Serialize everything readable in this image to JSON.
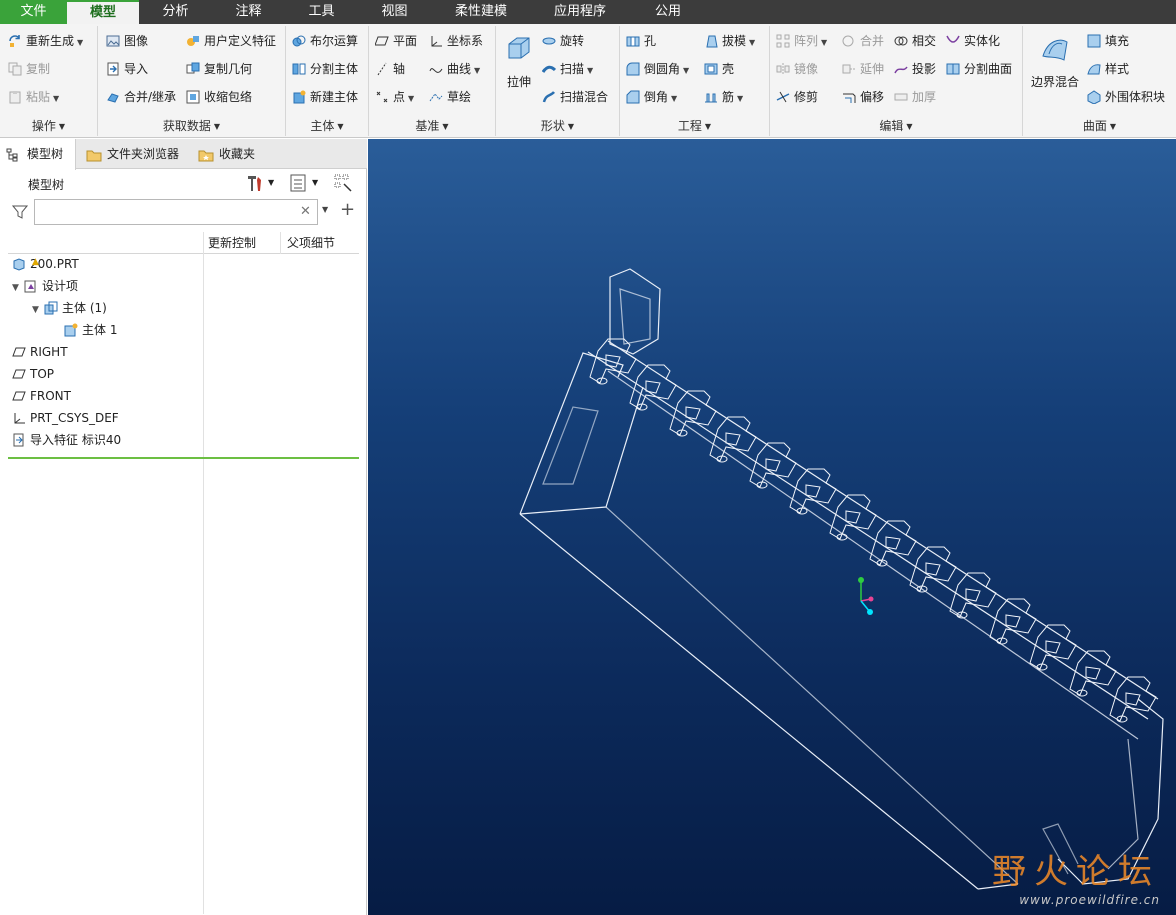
{
  "menu": {
    "tabs": [
      "文件",
      "模型",
      "分析",
      "注释",
      "工具",
      "视图",
      "柔性建模",
      "应用程序",
      "公用"
    ],
    "active": "模型"
  },
  "ribbon": {
    "ops": {
      "label": "操作",
      "regen": "重新生成",
      "copy": "复制",
      "paste": "粘贴"
    },
    "getdata": {
      "label": "获取数据",
      "image": "图像",
      "import": "导入",
      "merge": "合并/继承",
      "udf": "用户定义特征",
      "copygeom": "复制几何",
      "shrinkwrap": "收缩包络"
    },
    "body": {
      "label": "主体",
      "boolean": "布尔运算",
      "split": "分割主体",
      "newbody": "新建主体"
    },
    "datum": {
      "label": "基准",
      "plane": "平面",
      "csys": "坐标系",
      "axis": "轴",
      "curve": "曲线",
      "point": "点",
      "sketch": "草绘"
    },
    "shape": {
      "label": "形状",
      "extrude": "拉伸",
      "revolve": "旋转",
      "sweep": "扫描",
      "sweepblend": "扫描混合"
    },
    "eng": {
      "label": "工程",
      "hole": "孔",
      "draft": "拔模",
      "round": "倒圆角",
      "shell": "壳",
      "chamfer": "倒角",
      "rib": "筋"
    },
    "edit": {
      "label": "编辑",
      "pattern": "阵列",
      "merge": "合并",
      "intersect": "相交",
      "solidify": "实体化",
      "mirror": "镜像",
      "extend": "延伸",
      "project": "投影",
      "splitsurf": "分割曲面",
      "trim": "修剪",
      "offset": "偏移",
      "thicken": "加厚"
    },
    "surface": {
      "label": "曲面",
      "boundary": "边界混合",
      "fill": "填充",
      "style": "样式",
      "freestyle": "外围体积块"
    }
  },
  "panel": {
    "tabs": [
      "模型树",
      "文件夹浏览器",
      "收藏夹"
    ],
    "tree_title": "模型树",
    "search_placeholder": "",
    "columns": [
      "更新控制",
      "父项细节"
    ],
    "tree": [
      {
        "label": "200.PRT",
        "level": 0,
        "icon": "part-icon",
        "expander": ""
      },
      {
        "label": "设计项",
        "level": 0,
        "icon": "design-items-icon",
        "expander": "▼"
      },
      {
        "label": "主体 (1)",
        "level": 1,
        "icon": "bodies-icon",
        "expander": "▼"
      },
      {
        "label": "主体 1",
        "level": 2,
        "icon": "body-icon",
        "expander": ""
      },
      {
        "label": "RIGHT",
        "level": 0,
        "icon": "datum-plane-icon",
        "expander": ""
      },
      {
        "label": "TOP",
        "level": 0,
        "icon": "datum-plane-icon",
        "expander": ""
      },
      {
        "label": "FRONT",
        "level": 0,
        "icon": "datum-plane-icon",
        "expander": ""
      },
      {
        "label": "PRT_CSYS_DEF",
        "level": 0,
        "icon": "csys-icon",
        "expander": ""
      },
      {
        "label": "导入特征 标识40",
        "level": 0,
        "icon": "import-feature-icon",
        "expander": ""
      }
    ]
  },
  "watermark": {
    "text": "野火论坛",
    "url": "www.proewildfire.cn"
  },
  "colors": {
    "accent": "#3aa33a",
    "viewport_top": "#2a5d99",
    "viewport_bottom": "#061c44"
  }
}
